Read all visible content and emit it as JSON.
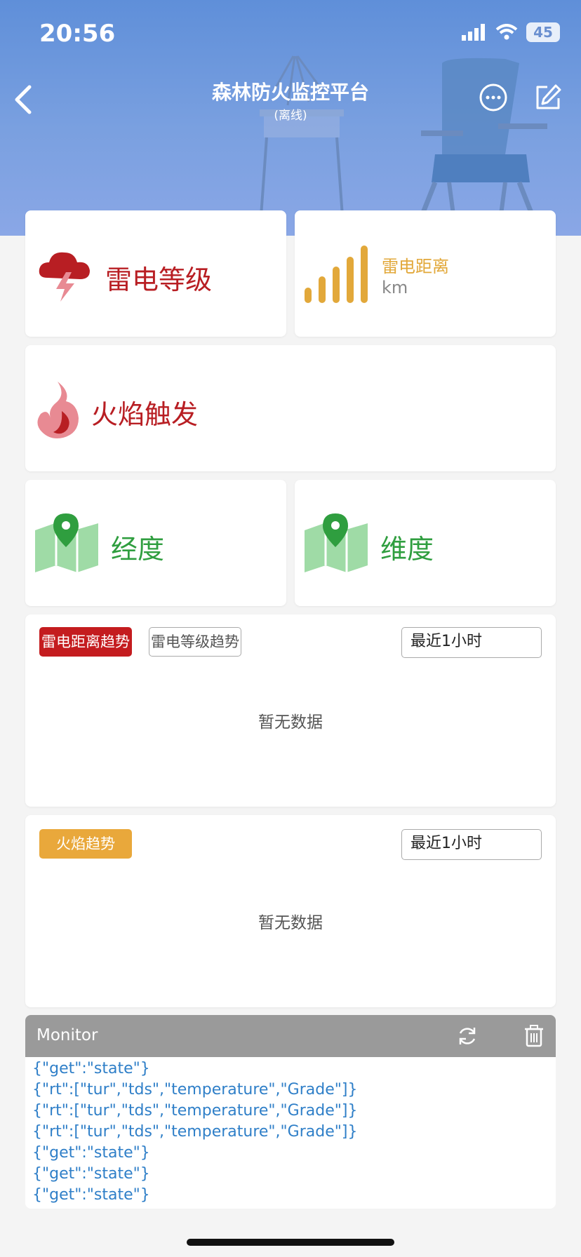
{
  "status_bar": {
    "time": "20:56",
    "battery": "45"
  },
  "nav": {
    "title": "森林防火监控平台",
    "subtitle": "(离线)"
  },
  "cards": {
    "thunder_level": {
      "label": "雷电等级"
    },
    "thunder_distance": {
      "label": "雷电距离",
      "unit": "km"
    },
    "flame_trigger": {
      "label": "火焰触发"
    },
    "longitude": {
      "label": "经度"
    },
    "latitude": {
      "label": "维度"
    }
  },
  "trend1": {
    "tabs": [
      "雷电距离趋势",
      "雷电等级趋势"
    ],
    "range": "最近1小时",
    "empty": "暂无数据"
  },
  "trend2": {
    "tab": "火焰趋势",
    "range": "最近1小时",
    "empty": "暂无数据"
  },
  "monitor": {
    "title": "Monitor",
    "lines": [
      "{\"get\":\"state\"}",
      "{\"rt\":[\"tur\",\"tds\",\"temperature\",\"Grade\"]}",
      "{\"rt\":[\"tur\",\"tds\",\"temperature\",\"Grade\"]}",
      "{\"rt\":[\"tur\",\"tds\",\"temperature\",\"Grade\"]}",
      "{\"get\":\"state\"}",
      "{\"get\":\"state\"}",
      "{\"get\":\"state\"}"
    ]
  },
  "colors": {
    "header": "#6f97dd",
    "red": "#b81e23",
    "orange": "#e2a83a",
    "green": "#2f9e3f",
    "log_blue": "#2f7fc8"
  },
  "icons": {
    "back": "chevron-left-icon",
    "more": "more-icon",
    "edit": "edit-icon",
    "thunder": "thunderstorm-icon",
    "signal": "signal-bars-icon",
    "flame": "flame-icon",
    "map": "map-pin-icon",
    "refresh": "refresh-icon",
    "trash": "trash-icon"
  }
}
